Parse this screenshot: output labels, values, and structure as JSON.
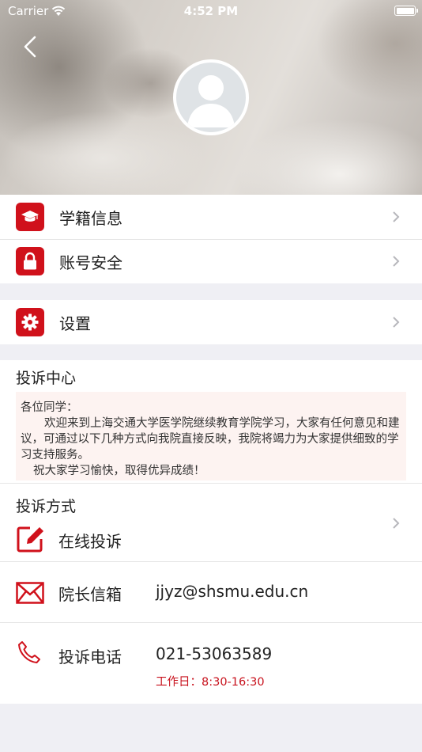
{
  "status_bar": {
    "carrier": "Carrier",
    "time": "4:52 PM"
  },
  "menu": [
    {
      "label": "学籍信息",
      "icon": "graduation-cap-icon"
    },
    {
      "label": "账号安全",
      "icon": "lock-icon"
    }
  ],
  "settings": {
    "label": "设置",
    "icon": "gear-icon"
  },
  "complaint_center": {
    "title": "投诉中心",
    "notice": {
      "greeting": "各位同学：",
      "body": "欢迎来到上海交通大学医学院继续教育学院学习，大家有任何意见和建议，可通过以下几种方式向我院直接反映，我院将竭力为大家提供细致的学习支持服务。",
      "closing": "祝大家学习愉快，取得优异成绩！"
    }
  },
  "complaint_methods": {
    "title": "投诉方式",
    "online": {
      "label": "在线投诉"
    },
    "mailbox": {
      "label": "院长信箱",
      "value": "jjyz@shsmu.edu.cn"
    },
    "phone": {
      "label": "投诉电话",
      "value": "021-53063589",
      "hours": "工作日：8:30-16:30"
    }
  },
  "colors": {
    "accent": "#d0111b",
    "background": "#efeff4"
  }
}
